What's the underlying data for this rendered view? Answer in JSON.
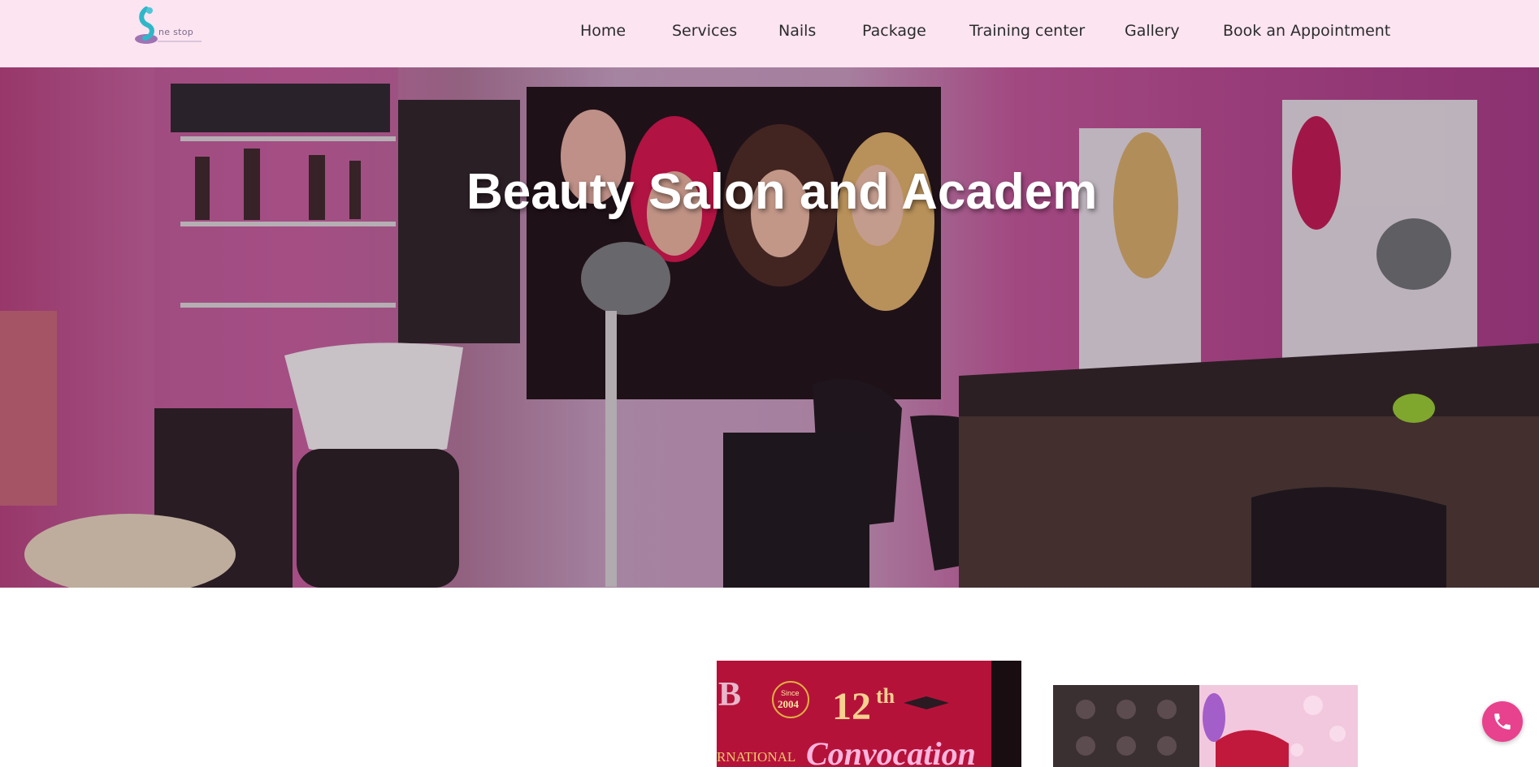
{
  "header": {
    "logo_text": "ne stop",
    "nav": [
      {
        "label": "Home"
      },
      {
        "label": "Services"
      },
      {
        "label": "Nails"
      },
      {
        "label": "Package"
      },
      {
        "label": "Training center"
      },
      {
        "label": "Gallery"
      },
      {
        "label": "Book an Appointment"
      }
    ]
  },
  "hero": {
    "title": "Beauty Salon and Academ"
  },
  "gallery": {
    "card1": {
      "since": "Since",
      "year": "2004",
      "number": "12",
      "suffix": "th",
      "word": "Convocation",
      "fragment": "RNATIONAL",
      "letter": "B"
    }
  },
  "colors": {
    "header_bg": "#fce4f1",
    "accent": "#e8418d",
    "wall_pink": "#c84f98"
  },
  "icons": {
    "call": "phone-icon"
  }
}
